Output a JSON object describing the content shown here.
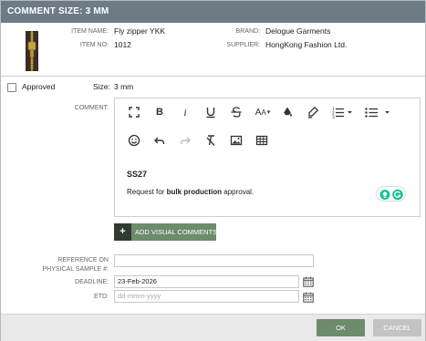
{
  "dialog": {
    "title": "COMMENT SIZE: 3 MM"
  },
  "item": {
    "name_label": "ITEM NAME:",
    "name": "Fly zipper YKK",
    "no_label": "ITEM NO:",
    "no": "1012",
    "brand_label": "BRAND:",
    "brand": "Delogue Garments",
    "supplier_label": "SUPPLIER:",
    "supplier": "HongKong Fashion Ltd."
  },
  "approval": {
    "approved_label": "Approved",
    "approved_checked": false,
    "size_label": "Size:",
    "size": "3 mm"
  },
  "comment": {
    "label": "COMMENT:",
    "title": "SS27",
    "body_prefix": "Request for ",
    "body_bold": "bulk production",
    "body_suffix": " approval.",
    "toolbar_icons": [
      "fullscreen-icon",
      "bold-icon",
      "italic-icon",
      "underline-icon",
      "strikethrough-icon",
      "font-size-icon",
      "text-color-icon",
      "highlight-icon",
      "ordered-list-icon",
      "unordered-list-icon",
      "emoji-icon",
      "undo-icon",
      "redo-icon",
      "clear-format-icon",
      "image-icon",
      "table-icon"
    ]
  },
  "visual": {
    "plus": "+",
    "label": "ADD VISUAL COMMENTS"
  },
  "fields": {
    "reference_label_line1": "REFERENCE ON",
    "reference_label_line2": "PHYSICAL SAMPLE #:",
    "reference_value": "",
    "deadline_label": "DEADLINE:",
    "deadline_value": "23-Feb-2026",
    "etd_label": "ETD:",
    "etd_placeholder": "dd-mmm-yyyy"
  },
  "footer": {
    "ok": "OK",
    "cancel": "CANCEL"
  },
  "colors": {
    "titlebar": "#6d7b87",
    "primary": "#6c8c6b",
    "primary_dark": "#2f3c2f",
    "cancel": "#c3c3c3",
    "grammarly": "#15c39a"
  }
}
